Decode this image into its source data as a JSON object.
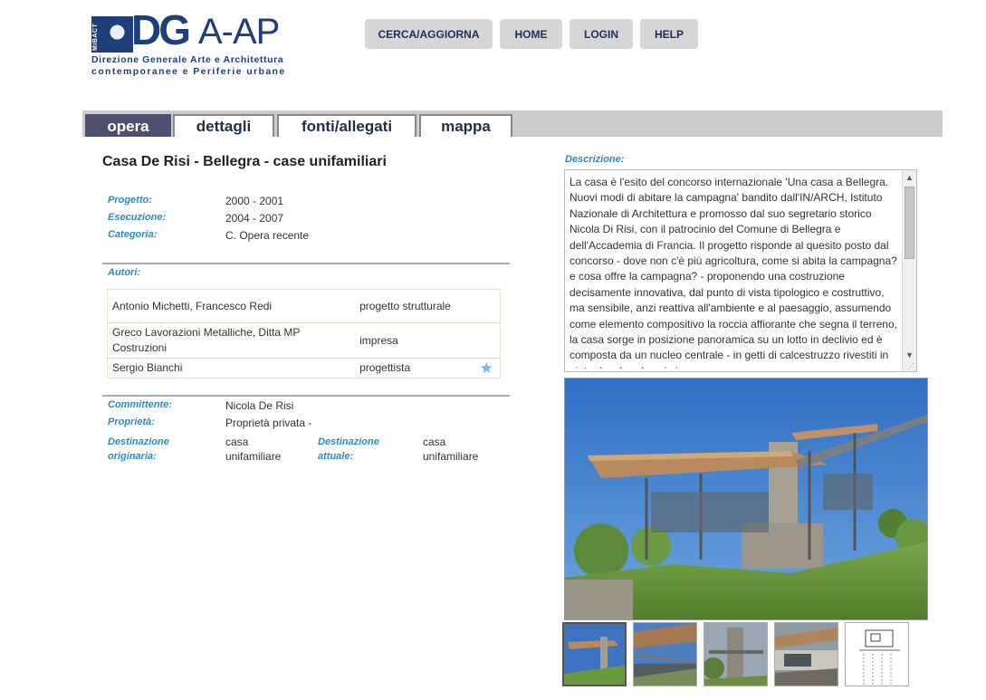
{
  "logo": {
    "emblem_text": "MiBACT",
    "brand_dg": "DG",
    "brand_aap": "A-AP",
    "line1": "Direzione Generale Arte e Architettura",
    "line2": "contemporanee e Periferie urbane",
    "color": "#1e3f7a"
  },
  "topnav": {
    "cerca": "CERCA/AGGIORNA",
    "home": "HOME",
    "login": "LOGIN",
    "help": "HELP"
  },
  "tabs": {
    "opera": "opera",
    "dettagli": "dettagli",
    "fonti": "fonti/allegati",
    "mappa": "mappa",
    "active": "opera"
  },
  "work": {
    "title": "Casa De Risi - Bellegra - case unifamiliari",
    "progetto_label": "Progetto:",
    "progetto": "2000 - 2001",
    "esecuzione_label": "Esecuzione:",
    "esecuzione": "2004 - 2007",
    "categoria_label": "Categoria:",
    "categoria": "C. Opera recente",
    "autori_label": "Autori:",
    "authors": [
      {
        "name": "Antonio Michetti, Francesco Redi",
        "role": "progetto strutturale"
      },
      {
        "name": "Greco Lavorazioni Metalliche, Ditta MP Costruzioni",
        "role": "impresa"
      },
      {
        "name": "Sergio Bianchi",
        "role": "progettista"
      }
    ],
    "committente_label": "Committente:",
    "committente": "Nicola De Risi",
    "proprieta_label": "Proprietà:",
    "proprieta": "Proprietà privata -",
    "dest_orig_label": "Destinazione originaria:",
    "dest_orig": "casa unifamiliare",
    "dest_att_label": "Destinazione attuale:",
    "dest_att": "casa unifamiliare"
  },
  "description": {
    "label": "Descrizione:",
    "text": "La casa è l'esito del concorso internazionale 'Una casa a Bellegra. Nuovi modi di abitare la campagna' bandito dall'IN/ARCH, Istituto Nazionale di Architettura e promosso dal suo segretario storico Nicola Di Risi, con il patrocinio del Comune di Bellegra e dell'Accademia di Francia. Il progetto risponde al quesito posto dal concorso - dove non c'è più agricoltura, come si abita la campagna? e cosa offre la campagna? - proponendo una costruzione decisamente innovativa, dal punto di vista tipologico e costruttivo, ma sensibile, anzi reattiva all'ambiente e al paesaggio, assumendo come elemento compositivo la roccia affiorante che segna il terreno, la casa sorge in posizione panoramica su un lotto in declivio ed è composta da un nucleo centrale - in getti di calcestruzzo rivestiti in pietra locale - da cui si"
  }
}
